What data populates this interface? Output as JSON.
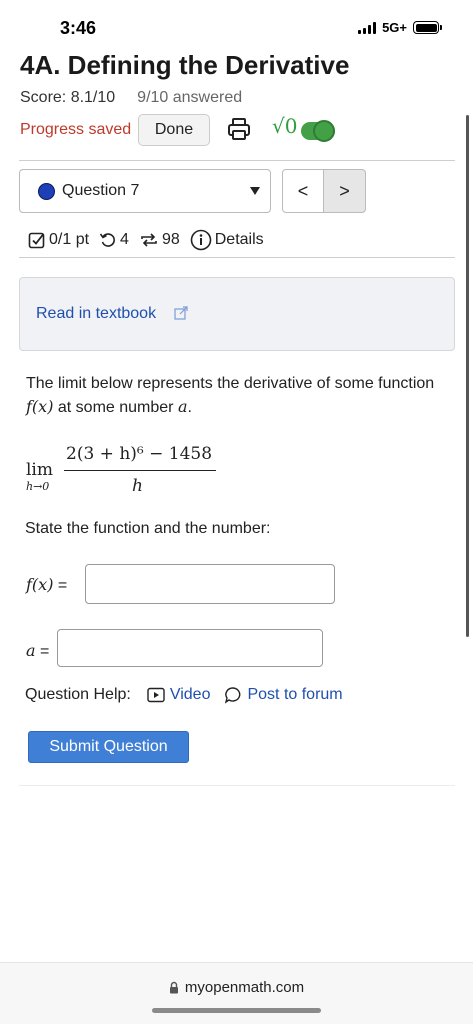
{
  "status_bar": {
    "time": "3:46",
    "network": "5G+"
  },
  "header": {
    "title": "4A. Defining the Derivative",
    "score": "Score: 8.1/10",
    "answered": "9/10 answered",
    "progress_saved": "Progress saved",
    "done_label": "Done",
    "sqrt_label": "√0"
  },
  "question_nav": {
    "selected": "Question 7",
    "prev": "<",
    "next": ">"
  },
  "details": {
    "points": "0/1 pt",
    "retries": "4",
    "submissions": "98",
    "details_label": "Details"
  },
  "textbook": {
    "link_label": "Read in textbook"
  },
  "question": {
    "intro_1": "The limit below represents the derivative of some function",
    "intro_fx": "f(x)",
    "intro_2": "at some number",
    "intro_a": "a",
    "intro_end": ".",
    "lim": "lim",
    "lim_sub": "h→0",
    "numerator": "2(3 + h)⁶ − 1458",
    "denominator": "h",
    "state": "State the function and the number:",
    "fx_label": "f(x)",
    "eq": "=",
    "a_label": "a",
    "fx_value": "",
    "a_value": ""
  },
  "help": {
    "label": "Question Help:",
    "video": "Video",
    "forum": "Post to forum"
  },
  "submit_label": "Submit Question",
  "browser": {
    "url": "myopenmath.com"
  },
  "colors": {
    "link": "#1f4fae",
    "submit": "#3f7fd6",
    "saved": "#c0392b",
    "toggle": "#43a047"
  }
}
